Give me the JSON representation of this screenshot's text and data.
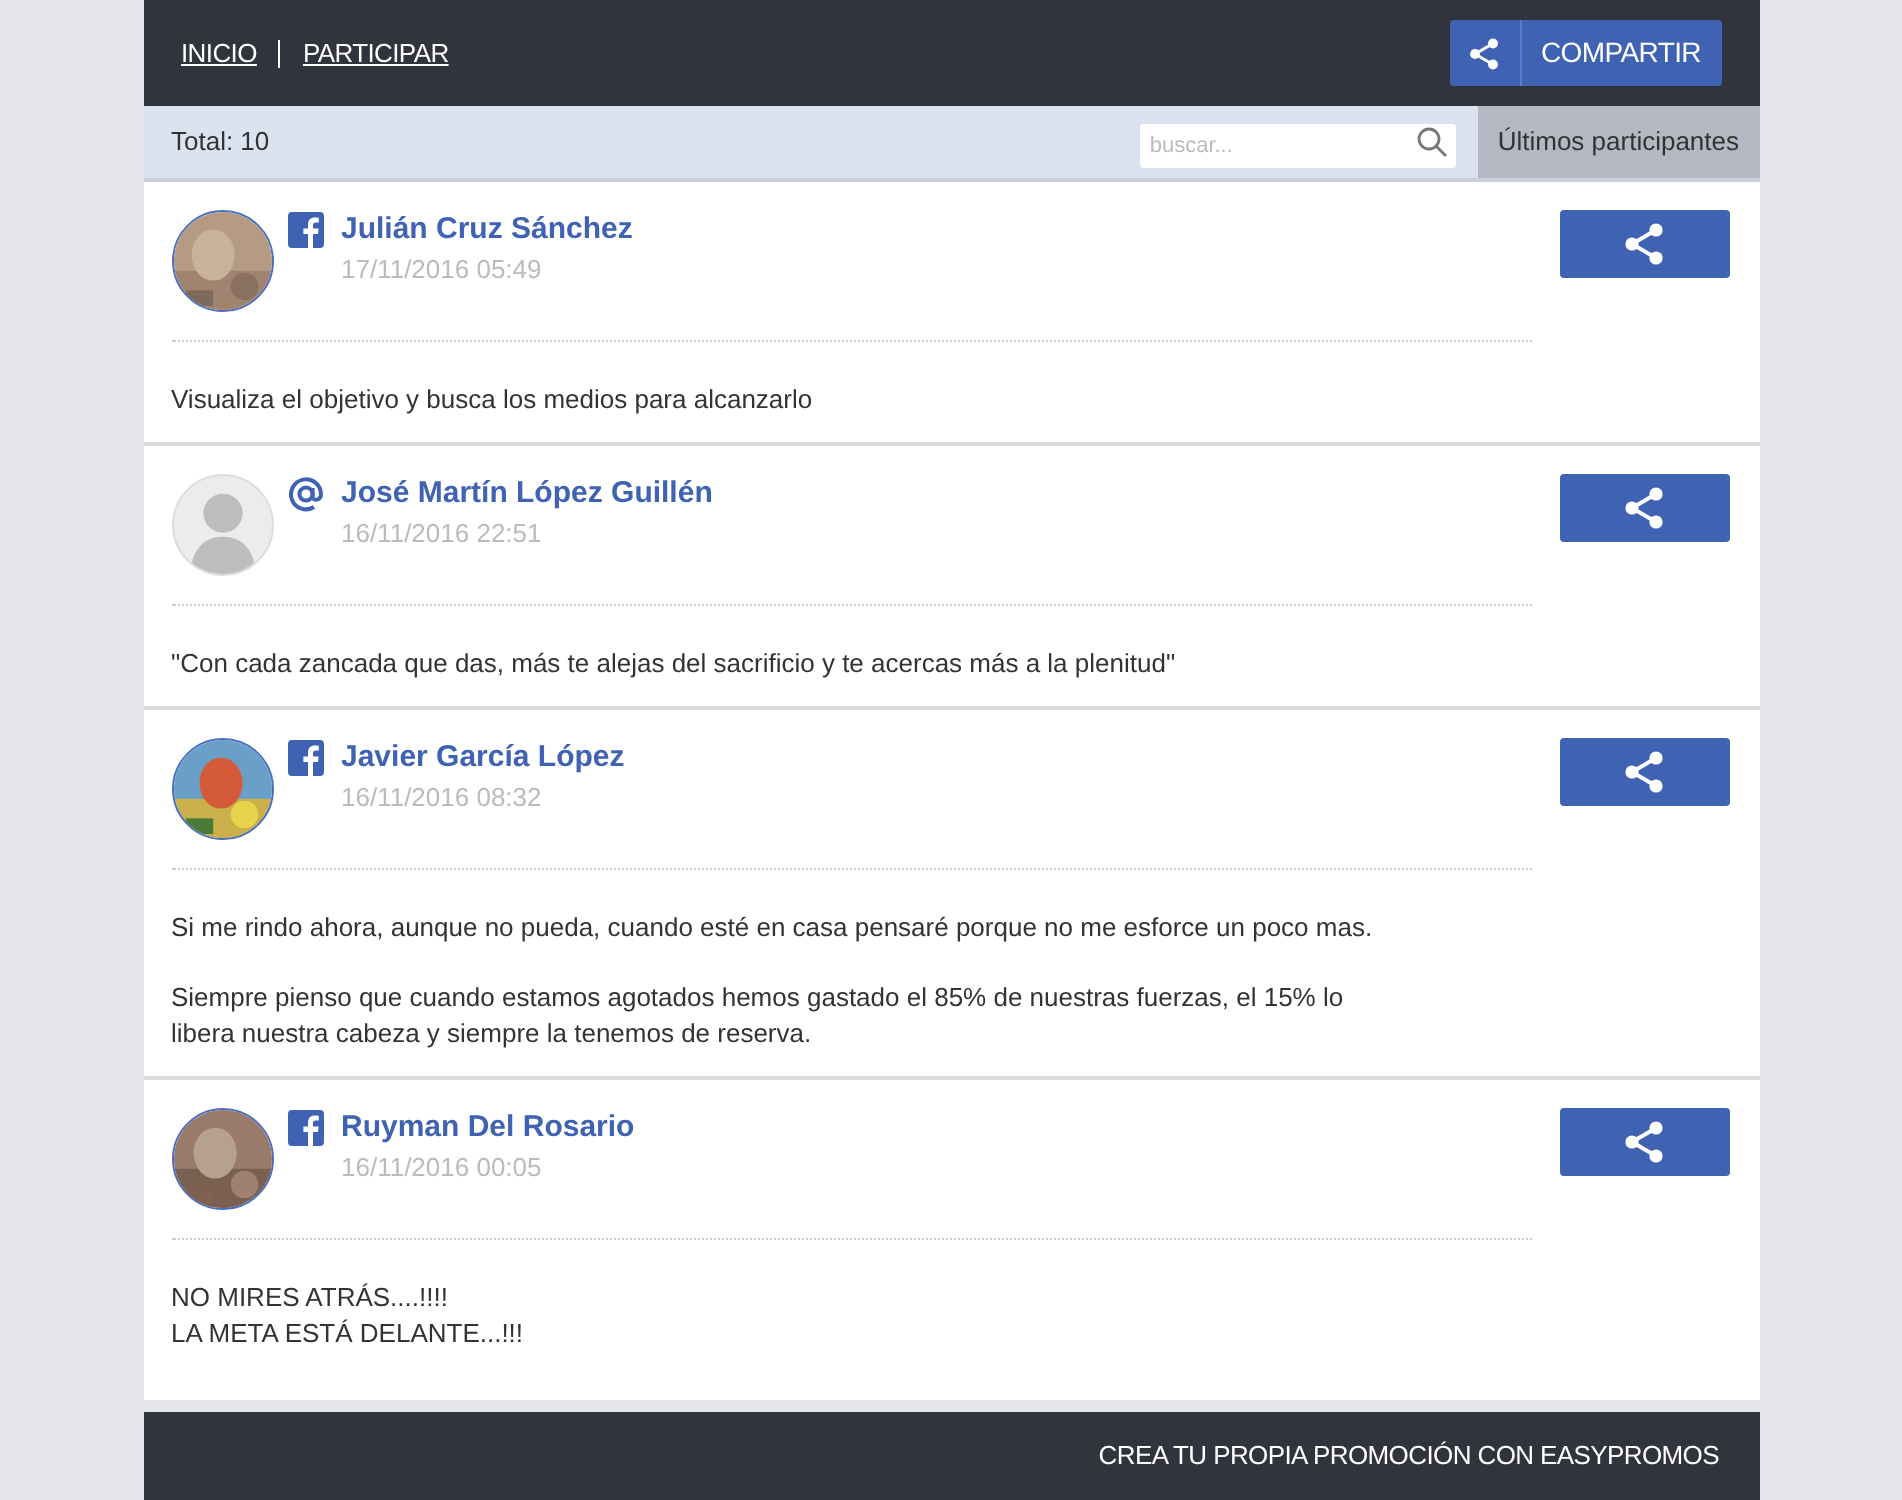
{
  "nav": {
    "links": [
      "INICIO",
      "PARTICIPAR"
    ],
    "share_button": "COMPARTIR"
  },
  "toolbar": {
    "total": "Total: 10",
    "search": {
      "placeholder": "buscar..."
    },
    "sort_tab": {
      "label": "Últimos participantes",
      "selected": true
    }
  },
  "entries": [
    {
      "avatar": {
        "kind": "picture"
      },
      "kind": "facebook",
      "name": "Julián Cruz Sánchez",
      "date": "17/11/2016 05:49",
      "paragraphs": [
        "Visualiza el objetivo y busca los medios para alcanzarlo"
      ]
    },
    {
      "avatar": {
        "kind": "default"
      },
      "kind": "email",
      "name": "José Martín López Guillén",
      "date": "16/11/2016 22:51",
      "paragraphs": [
        "\"Con cada zancada que das, más te alejas del sacrificio y te acercas más a la plenitud\""
      ]
    },
    {
      "avatar": {
        "kind": "picture"
      },
      "kind": "facebook",
      "name": "Javier García López",
      "date": "16/11/2016 08:32",
      "paragraphs": [
        "Si me rindo ahora, aunque no pueda, cuando esté en casa pensaré porque no me esforce un poco mas.",
        "Siempre pienso que cuando estamos agotados hemos gastado el 85% de nuestras fuerzas, el 15% lo libera nuestra cabeza y siempre la tenemos de reserva."
      ]
    },
    {
      "avatar": {
        "kind": "picture"
      },
      "kind": "facebook",
      "name": "Ruyman Del Rosario",
      "date": "16/11/2016 00:05",
      "paragraphs": [
        "NO MIRES ATRÁS....!!!!\nLA META ESTÁ DELANTE...!!!"
      ]
    }
  ],
  "footer": "CREA TU PROPIA PROMOCIÓN CON EASYPROMOS"
}
